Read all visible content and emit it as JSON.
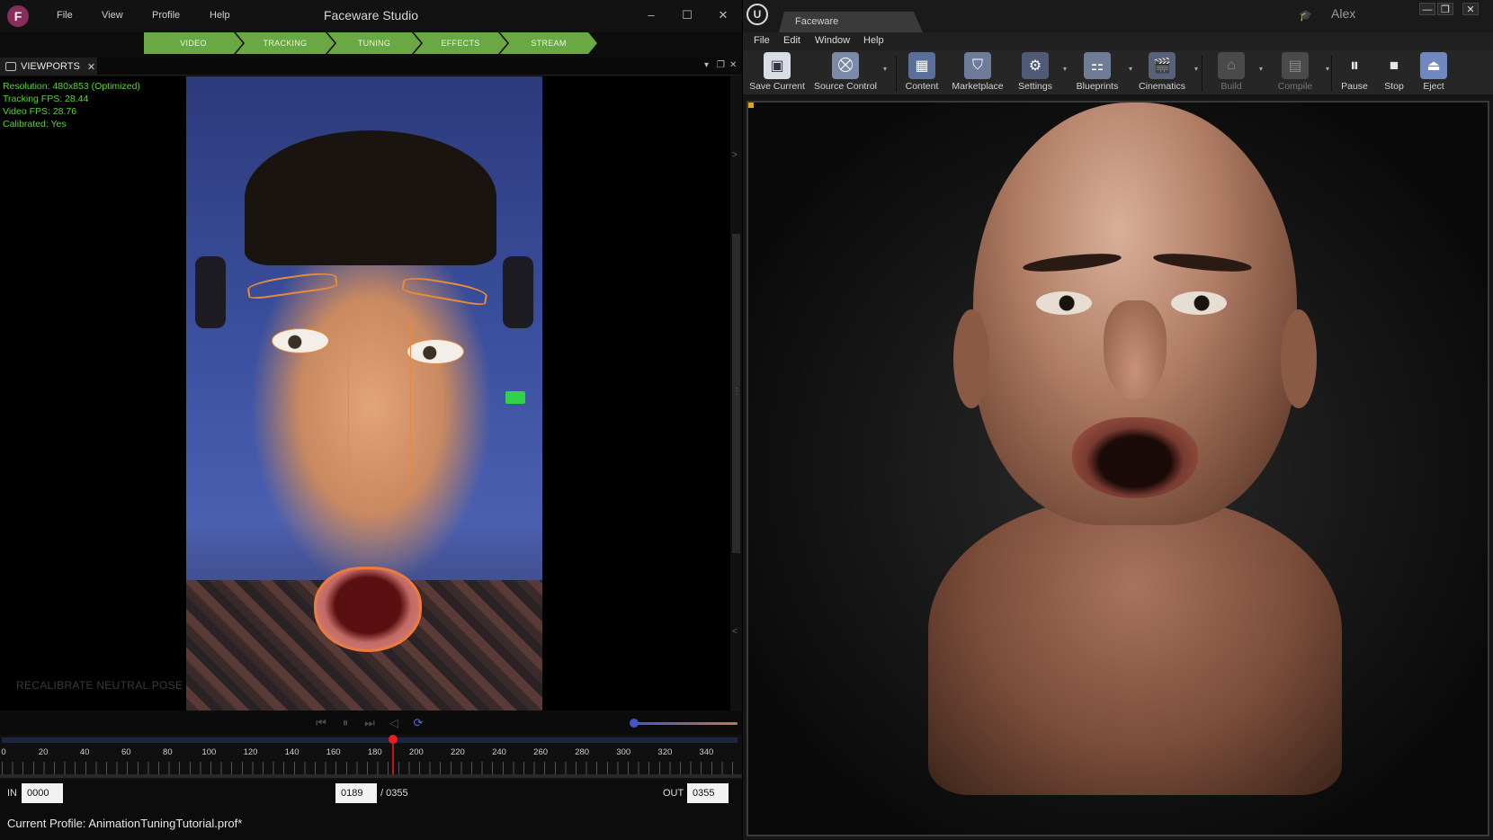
{
  "faceware": {
    "title": "Faceware Studio",
    "menu": [
      "File",
      "View",
      "Profile",
      "Help"
    ],
    "window_controls": [
      "–",
      "☐",
      "✕"
    ],
    "workflow_steps": [
      "VIDEO",
      "TRACKING",
      "TUNING",
      "EFFECTS",
      "STREAM"
    ],
    "step_color": "#6aa843",
    "panel_tab": {
      "label": "VIEWPORTS",
      "close": "✕"
    },
    "stats": {
      "resolution": "Resolution: 480x853 (Optimized)",
      "tracking_fps": "Tracking FPS: 28.44",
      "video_fps": "Video FPS: 28.76",
      "calibrated": "Calibrated: Yes"
    },
    "stats_color": "#5fd13a",
    "recalibrate_label": "RECALIBRATE NEUTRAL POSE",
    "timeline": {
      "ticks": [
        "0",
        "20",
        "40",
        "60",
        "80",
        "100",
        "120",
        "140",
        "160",
        "180",
        "200",
        "220",
        "240",
        "260",
        "280",
        "300",
        "320",
        "340"
      ],
      "min": 0,
      "max": 355,
      "current": 189
    },
    "frames": {
      "in_label": "IN",
      "in_value": "0000",
      "current_value": "0189",
      "total": "/ 0355",
      "out_label": "OUT",
      "out_value": "0355"
    },
    "status": "Current Profile: AnimationTuningTutorial.prof*"
  },
  "unreal": {
    "tab_title": "Faceware",
    "user": "Alex",
    "logo": "U",
    "window_controls": [
      "—",
      "❐",
      "✕"
    ],
    "menu": [
      "File",
      "Edit",
      "Window",
      "Help"
    ],
    "toolbar": [
      {
        "label": "Save Current",
        "icon": "save-icon"
      },
      {
        "label": "Source Control",
        "icon": "source-control-icon"
      },
      {
        "label": "Content",
        "icon": "content-icon"
      },
      {
        "label": "Marketplace",
        "icon": "marketplace-icon"
      },
      {
        "label": "Settings",
        "icon": "settings-icon"
      },
      {
        "label": "Blueprints",
        "icon": "blueprints-icon"
      },
      {
        "label": "Cinematics",
        "icon": "cinematics-icon"
      },
      {
        "label": "Build",
        "icon": "build-icon"
      },
      {
        "label": "Compile",
        "icon": "compile-icon"
      },
      {
        "label": "Pause",
        "icon": "pause-icon"
      },
      {
        "label": "Stop",
        "icon": "stop-icon"
      },
      {
        "label": "Eject",
        "icon": "eject-icon"
      }
    ]
  }
}
